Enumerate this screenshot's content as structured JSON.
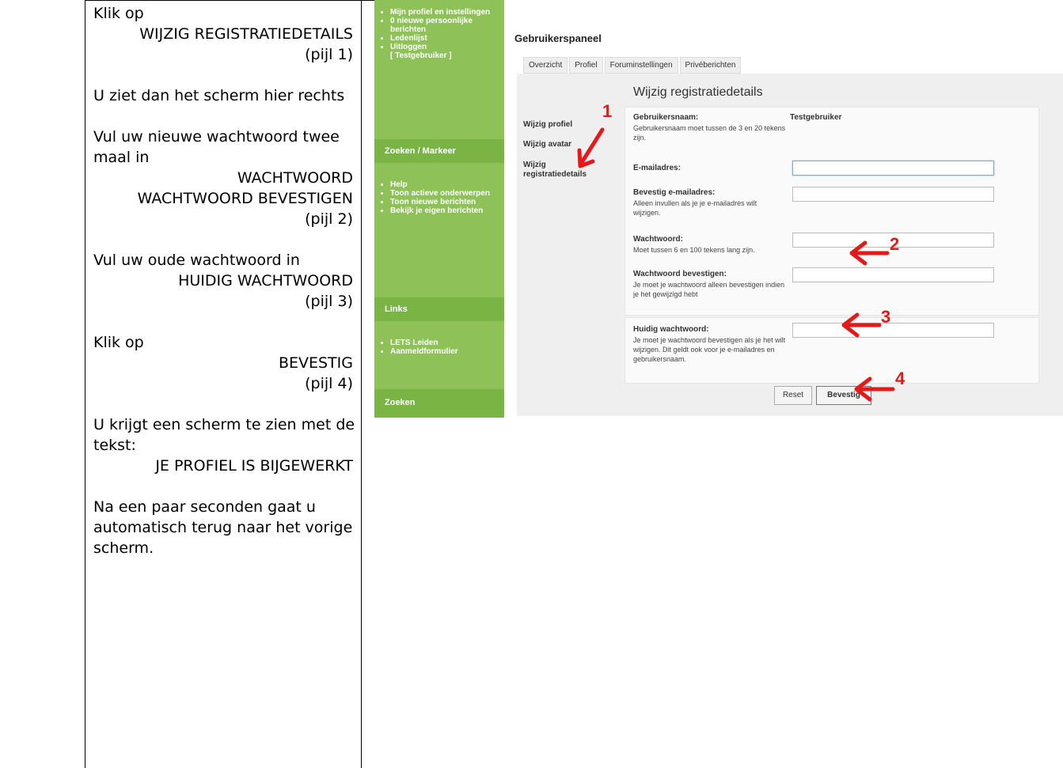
{
  "instructions": {
    "lines": [
      {
        "text": "Klik op",
        "align": "left"
      },
      {
        "text": "WIJZIG REGISTRATIEDETAILS",
        "align": "right"
      },
      {
        "text": "(pijl 1)",
        "align": "right"
      },
      {
        "text": "",
        "align": "left"
      },
      {
        "text": "U ziet dan het scherm hier rechts",
        "align": "left"
      },
      {
        "text": "",
        "align": "left"
      },
      {
        "text": "Vul uw nieuwe wachtwoord twee",
        "align": "left"
      },
      {
        "text": "maal in",
        "align": "left"
      },
      {
        "text": "WACHTWOORD",
        "align": "right"
      },
      {
        "text": "WACHTWOORD BEVESTIGEN",
        "align": "right"
      },
      {
        "text": "(pijl 2)",
        "align": "right"
      },
      {
        "text": "",
        "align": "left"
      },
      {
        "text": "Vul uw oude wachtwoord in",
        "align": "left"
      },
      {
        "text": "HUIDIG WACHTWOORD",
        "align": "right"
      },
      {
        "text": "(pijl 3)",
        "align": "right"
      },
      {
        "text": "",
        "align": "left"
      },
      {
        "text": "Klik op",
        "align": "left"
      },
      {
        "text": "BEVESTIG",
        "align": "right"
      },
      {
        "text": "(pijl 4)",
        "align": "right"
      },
      {
        "text": "",
        "align": "left"
      },
      {
        "text": "U krijgt een scherm te zien met de",
        "align": "left"
      },
      {
        "text": "tekst:",
        "align": "left"
      },
      {
        "text": "JE PROFIEL IS BIJGEWERKT",
        "align": "right"
      },
      {
        "text": "",
        "align": "left"
      },
      {
        "text": "Na een paar seconden gaat u",
        "align": "left"
      },
      {
        "text": "automatisch terug naar het vorige",
        "align": "left"
      },
      {
        "text": "scherm.",
        "align": "left"
      }
    ]
  },
  "sidebar": {
    "menu1": [
      "Mijn profiel en instellingen",
      "0 nieuwe persoonlijke berichten",
      "Ledenlijst",
      "Uitloggen"
    ],
    "menu1_sub": "[ Testgebruiker ]",
    "section2_title": "Zoeken / Markeer",
    "menu2": [
      "Help",
      "Toon actieve onderwerpen",
      "Toon nieuwe berichten",
      "Bekijk je eigen berichten"
    ],
    "section3_title": "Links",
    "menu3": [
      "LETS Leiden",
      "Aanmeldformulier"
    ],
    "section4_title": "Zoeken"
  },
  "panel": {
    "title": "Gebruikerspaneel",
    "tabs": [
      "Overzicht",
      "Profiel",
      "Foruminstellingen",
      "Privéberichten"
    ],
    "subnav": [
      "Wijzig profiel",
      "Wijzig avatar",
      "Wijzig registratiedetails"
    ],
    "form_title": "Wijzig registratiedetails",
    "username_label": "Gebruikersnaam:",
    "username_hint": "Gebruikersnaam moet tussen de 3 en 20 tekens zijn.",
    "username_value": "Testgebruiker",
    "email_label": "E-mailadres:",
    "email_confirm_label": "Bevestig e-mailadres:",
    "email_confirm_hint": "Alleen invullen als je je e-mailadres wilt wijzigen.",
    "password_label": "Wachtwoord:",
    "password_hint": "Moet tussen 6 en 100 tekens lang zijn.",
    "password_confirm_label": "Wachtwoord bevestigen:",
    "password_confirm_hint": "Je moet je wachtwoord alleen bevestigen indien je het gewijzigd hebt",
    "current_password_label": "Huidig wachtwoord:",
    "current_password_hint": "Je moet je wachtwoord bevestigen als je het wilt wijzigen. Dit geldt ook voor je e-mailadres en gebruikersnaam.",
    "reset_label": "Reset",
    "submit_label": "Bevestig"
  },
  "annotations": {
    "n1": "1",
    "n2": "2",
    "n3": "3",
    "n4": "4",
    "color": "#e21a1a"
  },
  "colors": {
    "sidebar": "#8ec258",
    "panel_bg": "#efefef"
  }
}
